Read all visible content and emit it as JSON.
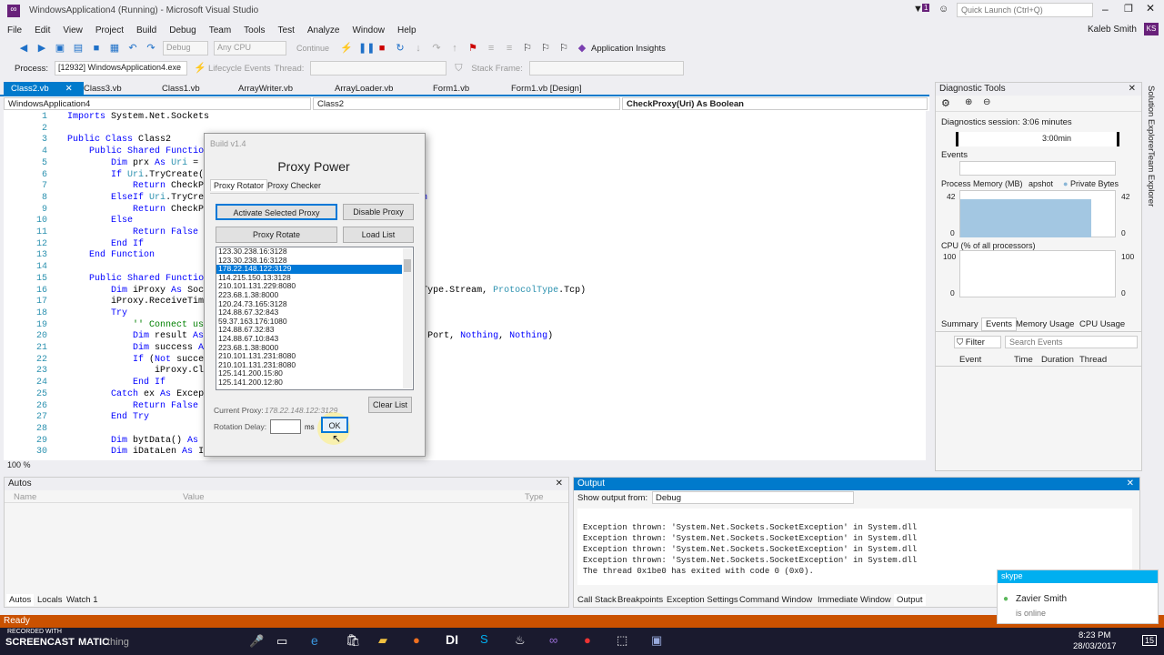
{
  "window": {
    "title": "WindowsApplication4 (Running) - Microsoft Visual Studio",
    "quick_launch": "Quick Launch (Ctrl+Q)",
    "notif_count": "1",
    "user": "Kaleb Smith",
    "initials": "KS"
  },
  "menu": [
    "File",
    "Edit",
    "View",
    "Project",
    "Build",
    "Debug",
    "Team",
    "Tools",
    "Test",
    "Analyze",
    "Window",
    "Help"
  ],
  "toolbar": {
    "config": "Debug",
    "platform": "Any CPU",
    "continue": "Continue",
    "insights": "Application Insights"
  },
  "procbar": {
    "process_label": "Process:",
    "process": "[12932] WindowsApplication4.exe",
    "lifecycle": "Lifecycle Events",
    "thread": "Thread:",
    "stack": "Stack Frame:"
  },
  "tabs": [
    "Class2.vb",
    "Class3.vb",
    "Class1.vb",
    "ArrayWriter.vb",
    "ArrayLoader.vb",
    "Form1.vb",
    "Form1.vb [Design]"
  ],
  "nav": {
    "project": "WindowsApplication4",
    "class": "Class2",
    "method": "CheckProxy(Uri) As Boolean"
  },
  "code": [
    {
      "n": "1",
      "t": "Imports System.Net.Sockets"
    },
    {
      "n": "2",
      "t": ""
    },
    {
      "n": "3",
      "t": "Public Class Class2"
    },
    {
      "n": "4",
      "t": "    Public Shared Function"
    },
    {
      "n": "5",
      "t": "        Dim prx As Uri = No"
    },
    {
      "n": "6",
      "t": "        If Uri.TryCreate(Pr"
    },
    {
      "n": "7",
      "t": "            Return CheckPro"
    },
    {
      "n": "8",
      "t": "        ElseIf Uri.TryCreat                                   Then"
    },
    {
      "n": "9",
      "t": "            Return CheckPro"
    },
    {
      "n": "10",
      "t": "        Else"
    },
    {
      "n": "11",
      "t": "            Return False"
    },
    {
      "n": "12",
      "t": "        End If"
    },
    {
      "n": "13",
      "t": "    End Function"
    },
    {
      "n": "14",
      "t": ""
    },
    {
      "n": "15",
      "t": "    Public Shared Function"
    },
    {
      "n": "16",
      "t": "        Dim iProxy As Socke                                 ocketType.Stream, ProtocolType.Tcp)"
    },
    {
      "n": "17",
      "t": "        iProxy.ReceiveTimeo"
    },
    {
      "n": "18",
      "t": "        Try"
    },
    {
      "n": "19",
      "t": "            '' Connect usin"
    },
    {
      "n": "20",
      "t": "            Dim result As I                                 Proxy.Port, Nothing, Nothing)"
    },
    {
      "n": "21",
      "t": "            Dim success As                                  True)"
    },
    {
      "n": "22",
      "t": "            If (Not success"
    },
    {
      "n": "23",
      "t": "                iProxy.Clos"
    },
    {
      "n": "24",
      "t": "            End If"
    },
    {
      "n": "25",
      "t": "        Catch ex As Excepti"
    },
    {
      "n": "26",
      "t": "            Return False"
    },
    {
      "n": "27",
      "t": "        End Try"
    },
    {
      "n": "28",
      "t": ""
    },
    {
      "n": "29",
      "t": "        Dim bytData() As By"
    },
    {
      "n": "30",
      "t": "        Dim iDataLen As Integ"
    }
  ],
  "editor_footer": {
    "zoom": "100 %"
  },
  "diag": {
    "title": "Diagnostic Tools",
    "session": "Diagnostics session: 3:06 minutes",
    "time": "3:00min",
    "events": "Events",
    "memory": "Process Memory (MB)",
    "snapshot": "apshot",
    "private": "Private Bytes",
    "mem_max": "42",
    "mem_min": "0",
    "cpu": "CPU (% of all processors)",
    "cpu_max": "100",
    "cpu_min": "0",
    "tabs": [
      "Summary",
      "Events",
      "Memory Usage",
      "CPU Usage"
    ],
    "filter": "Filter",
    "search": "Search Events",
    "cols": [
      "Event",
      "Time",
      "Duration",
      "Thread"
    ]
  },
  "vtabs": [
    "Solution Explorer",
    "Team Explorer"
  ],
  "autos": {
    "title": "Autos",
    "cols": [
      "Name",
      "Value",
      "Type"
    ],
    "tabs": [
      "Autos",
      "Locals",
      "Watch 1"
    ]
  },
  "output": {
    "title": "Output",
    "show_from": "Show output from:",
    "source": "Debug",
    "lines": [
      "Exception thrown: 'System.Net.Sockets.SocketException' in System.dll",
      "Exception thrown: 'System.Net.Sockets.SocketException' in System.dll",
      "Exception thrown: 'System.Net.Sockets.SocketException' in System.dll",
      "Exception thrown: 'System.Net.Sockets.SocketException' in System.dll",
      "The thread 0x1be0 has exited with code 0 (0x0)."
    ],
    "tabs": [
      "Call Stack",
      "Breakpoints",
      "Exception Settings",
      "Command Window",
      "Immediate Window",
      "Output"
    ]
  },
  "status": "Ready",
  "dialog": {
    "build": "Build v1.4",
    "title": "Proxy Power",
    "tabs": [
      "Proxy Rotator",
      "Proxy Checker"
    ],
    "activate": "Activate Selected Proxy",
    "disable": "Disable Proxy",
    "rotate": "Proxy Rotate",
    "load": "Load List",
    "clear": "Clear List",
    "current_label": "Current Proxy:",
    "current": "178.22.148.122:3129",
    "delay_label": "Rotation Delay:",
    "ms": "ms",
    "ok": "OK",
    "proxies": [
      "123.30.238.16:3128",
      "123.30.238.16:3128",
      "178.22.148.122:3129",
      "114.215.150.13:3128",
      "210.101.131.229:8080",
      "223.68.1.38:8000",
      "120.24.73.165:3128",
      "124.88.67.32:843",
      "59.37.163.176:1080",
      "124.88.67.32:83",
      "124.88.67.10:843",
      "223.68.1.38:8000",
      "210.101.131.231:8080",
      "210.101.131.231:8080",
      "125.141.200.15:80",
      "125.141.200.12:80"
    ],
    "selected_index": 2
  },
  "skype": {
    "app": "skype",
    "name": "Zavier Smith",
    "status": "is online"
  },
  "taskbar": {
    "recorded": "RECORDED WITH",
    "brand": "SCREENCAST",
    "brand2": "MATIC",
    "search": "thing",
    "time": "8:23 PM",
    "date": "28/03/2017",
    "badge": "15"
  }
}
